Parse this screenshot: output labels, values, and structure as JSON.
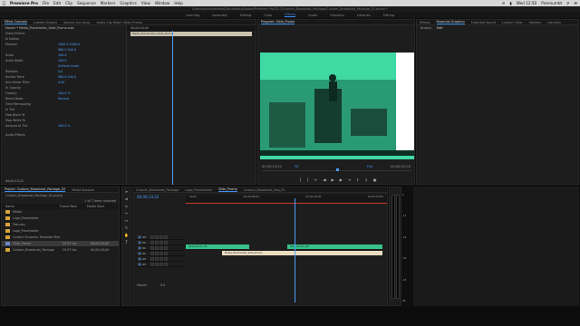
{
  "menubar": {
    "app_name": "Premiere Pro",
    "items": [
      "File",
      "Edit",
      "Clip",
      "Sequence",
      "Markers",
      "Graphics",
      "View",
      "Window",
      "Help"
    ],
    "clock": "Wed 12:50",
    "user": "Premiumbt"
  },
  "titlebar": {
    "path": "/Users/premiumbeat/Documents/Adobe/Premiere Pro/12.0/Custom_Broadcast_Package/Custom_Broadcast_Package_02.prproj *"
  },
  "workspaces": {
    "items": [
      "Learning",
      "Assembly",
      "Editing",
      "Color",
      "Effects",
      "Audio",
      "Graphics",
      "Libraries",
      "Editing"
    ],
    "active_index": 4
  },
  "effect_controls": {
    "tabs": [
      "Effect Controls",
      "Lumetri Scopes",
      "Source: (no clips)",
      "Audio Clip Mixer: Slide_Promo"
    ],
    "header": "Master * Media_Placeholder_Slide_Promo.mov",
    "clip_label": "Slide_Promo * Media_Placeholder_Slide_Promo",
    "timecode_start": "00;00;00;00",
    "clip_bar_label": "Media_Placeholder_Slide_Promo",
    "section_video": "Video Effects",
    "section_audio": "Audio Effects",
    "rows": [
      {
        "label": "fx  Motion",
        "value": ""
      },
      {
        "label": "Position",
        "value": "1000.0   1000.0"
      },
      {
        "label": "",
        "value": "960.0   540.0"
      },
      {
        "label": "Scale",
        "value": "100.0"
      },
      {
        "label": "Scale Width",
        "value": "100.0"
      },
      {
        "label": "",
        "value": "Uniform Scale"
      },
      {
        "label": "Rotation",
        "value": "0.0"
      },
      {
        "label": "Anchor Point",
        "value": "960.0   540.0"
      },
      {
        "label": "Anti-flicker Filter",
        "value": "0.00"
      },
      {
        "label": "fx  Opacity",
        "value": ""
      },
      {
        "label": "Opacity",
        "value": "100.0 %"
      },
      {
        "label": "Blend Mode",
        "value": "Normal"
      },
      {
        "label": "Time Remapping",
        "value": ""
      },
      {
        "label": "fx  Tint",
        "value": ""
      },
      {
        "label": "Map Black To",
        "value": ""
      },
      {
        "label": "Map White To",
        "value": ""
      },
      {
        "label": "Amount to Tint",
        "value": "100.0 %"
      }
    ],
    "footer_timecode": "00;00;13;22"
  },
  "program": {
    "title": "Program: Slide_Promo",
    "timecode_left": "00;00;13;22",
    "fit": "Fit",
    "quality": "Full",
    "timecode_right": "00;00;22;03",
    "controls": [
      "mark-in",
      "mark-out",
      "go-to-in",
      "step-back",
      "play",
      "step-forward",
      "go-to-out",
      "lift",
      "extract",
      "export-frame"
    ]
  },
  "graphics_panel": {
    "tabs": [
      "Effects",
      "Essential Graphics",
      "Essential Sound",
      "Lumetri Color",
      "Markers",
      "Libraries"
    ],
    "subtabs": [
      "Browse",
      "Edit"
    ]
  },
  "project": {
    "tabs": [
      "Project: Custom_Broadcast_Package_02",
      "Media Browser"
    ],
    "path": "Custom_Broadcast_Package_02.prproj",
    "count": "1 of 7 items selected",
    "columns": [
      "Name",
      "Frame Rate",
      "Media Start"
    ],
    "items": [
      {
        "type": "folder",
        "name": "Media",
        "rate": "",
        "start": ""
      },
      {
        "type": "folder",
        "name": "Logo_Placeholder",
        "rate": "",
        "start": ""
      },
      {
        "type": "folder",
        "name": "Textures",
        "rate": "",
        "start": ""
      },
      {
        "type": "folder",
        "name": "Logo_Placeholder",
        "rate": "",
        "start": ""
      },
      {
        "type": "folder",
        "name": "Custom Graphics Template Media",
        "rate": "",
        "start": ""
      },
      {
        "type": "sequence",
        "name": "Slide_Promo",
        "rate": "29.97 fps",
        "start": "00;00;00;00"
      },
      {
        "type": "folder",
        "name": "Custom_Broadcast_Package",
        "rate": "29.97 fps",
        "start": "00;00;00;00"
      }
    ],
    "selected_index": 5
  },
  "timeline": {
    "tabs": [
      "Custom_Broadcast_Package",
      "Logo_Placeholder",
      "Slide_Promo",
      "Custom_Broadcast_Seq_01"
    ],
    "active_tab": 2,
    "timecode": "00;00;13;22",
    "ruler": [
      "00;00",
      "00;00;08;00",
      "00;00;16;00",
      "00;00;24;00"
    ],
    "tracks": [
      "V3",
      "V2",
      "V1",
      "A1",
      "A2",
      "A3",
      "Master"
    ],
    "master_value": "0.0",
    "clips": {
      "v_left": "Slide_Promo_05",
      "v_right": "Slide_Promo_06",
      "a1": "Media_Placeholder_Slide_Promo"
    }
  },
  "audio_meter": {
    "scale": [
      "0",
      "-12",
      "-24",
      "-36",
      "-48",
      "dB"
    ]
  },
  "colors": {
    "accent": "#3d8ef0",
    "clip_video": "#37bf8c",
    "clip_audio": "#e9dcc0",
    "folder": "#d9a43a",
    "playhead": "#4c9dff"
  }
}
